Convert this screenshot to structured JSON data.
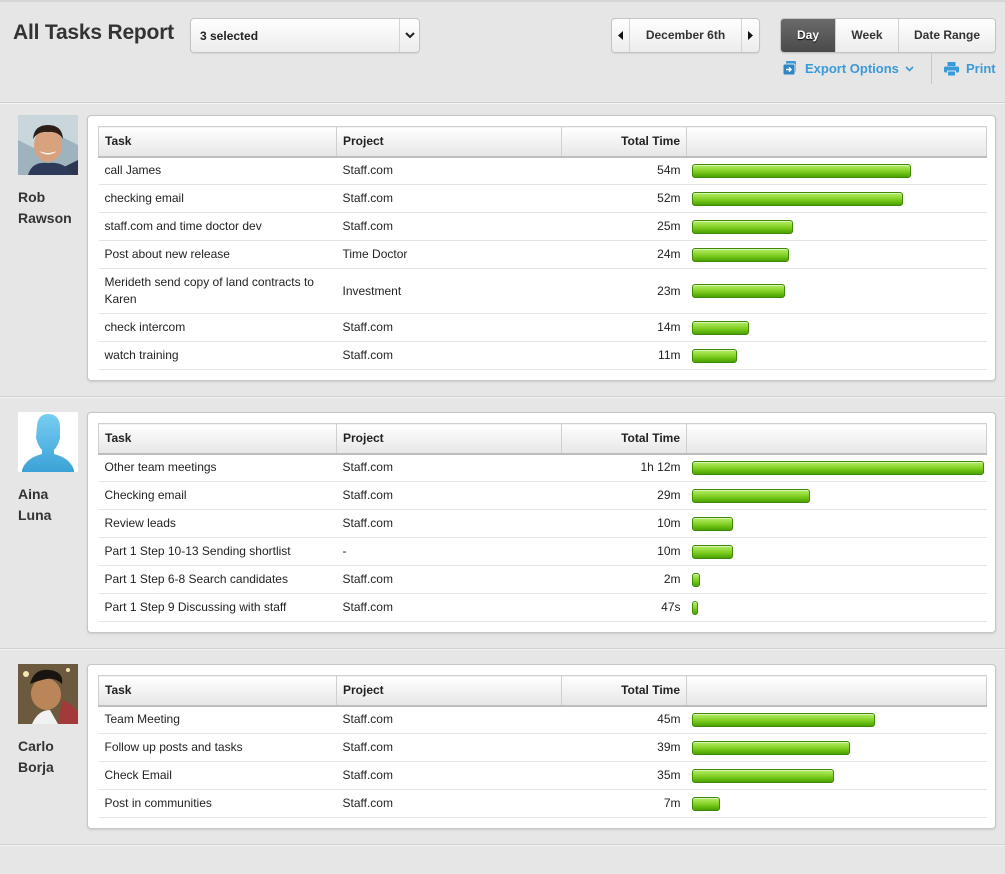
{
  "header": {
    "title": "All Tasks Report",
    "user_select": {
      "value": "3 selected"
    },
    "date_nav": {
      "date": "December 6th"
    },
    "period_tabs": [
      {
        "label": "Day",
        "active": true
      },
      {
        "label": "Week",
        "active": false
      },
      {
        "label": "Date Range",
        "active": false
      }
    ],
    "export_label": "Export Options",
    "print_label": "Print"
  },
  "colors": {
    "accent_link": "#3a9ad9",
    "bar_green": "#6cc012",
    "active_tab": "#555555"
  },
  "table_columns": {
    "task": "Task",
    "project": "Project",
    "total_time": "Total Time"
  },
  "users": [
    {
      "first_name": "Rob",
      "last_name": "Rawson",
      "avatar": "photo",
      "tasks": [
        {
          "task": "call James",
          "project": "Staff.com",
          "time": "54m",
          "minutes": 54
        },
        {
          "task": "checking email",
          "project": "Staff.com",
          "time": "52m",
          "minutes": 52
        },
        {
          "task": "staff.com and time doctor dev",
          "project": "Staff.com",
          "time": "25m",
          "minutes": 25
        },
        {
          "task": "Post about new release",
          "project": "Time Doctor",
          "time": "24m",
          "minutes": 24
        },
        {
          "task": "Merideth send copy of land contracts to Karen",
          "project": "Investment",
          "time": "23m",
          "minutes": 23
        },
        {
          "task": "check intercom",
          "project": "Staff.com",
          "time": "14m",
          "minutes": 14
        },
        {
          "task": "watch training",
          "project": "Staff.com",
          "time": "11m",
          "minutes": 11
        }
      ]
    },
    {
      "first_name": "Aina",
      "last_name": "Luna",
      "avatar": "default-silhouette",
      "tasks": [
        {
          "task": "Other team meetings",
          "project": "Staff.com",
          "time": "1h 12m",
          "minutes": 72
        },
        {
          "task": "Checking email",
          "project": "Staff.com",
          "time": "29m",
          "minutes": 29
        },
        {
          "task": "Review leads",
          "project": "Staff.com",
          "time": "10m",
          "minutes": 10
        },
        {
          "task": "Part 1 Step 10-13 Sending shortlist",
          "project": "-",
          "time": "10m",
          "minutes": 10
        },
        {
          "task": "Part 1 Step 6-8 Search candidates",
          "project": "Staff.com",
          "time": "2m",
          "minutes": 2
        },
        {
          "task": "Part 1 Step 9 Discussing with staff",
          "project": "Staff.com",
          "time": "47s",
          "minutes": 0.78
        }
      ]
    },
    {
      "first_name": "Carlo",
      "last_name": "Borja",
      "avatar": "photo",
      "tasks": [
        {
          "task": "Team Meeting",
          "project": "Staff.com",
          "time": "45m",
          "minutes": 45
        },
        {
          "task": "Follow up posts and tasks",
          "project": "Staff.com",
          "time": "39m",
          "minutes": 39
        },
        {
          "task": "Check Email",
          "project": "Staff.com",
          "time": "35m",
          "minutes": 35
        },
        {
          "task": "Post in communities",
          "project": "Staff.com",
          "time": "7m",
          "minutes": 7
        }
      ]
    }
  ],
  "bar_scale_max_minutes": 72
}
